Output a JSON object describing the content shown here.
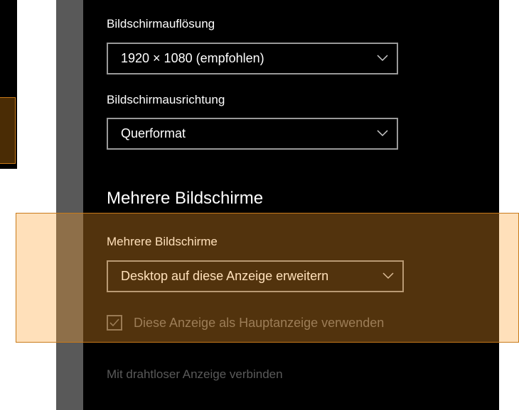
{
  "display": {
    "resolution_label": "Bildschirmauflösung",
    "resolution_value": "1920 × 1080 (empfohlen)",
    "orientation_label": "Bildschirmausrichtung",
    "orientation_value": "Querformat"
  },
  "multi_display": {
    "section_title": "Mehrere Bildschirme",
    "select_label": "Mehrere Bildschirme",
    "select_value": "Desktop auf diese Anzeige erweitern",
    "main_display_checkbox_label": "Diese Anzeige als Hauptanzeige verwenden",
    "main_display_checked": true,
    "wireless_link": "Mit drahtloser Anzeige verbinden"
  },
  "colors": {
    "background": "#000000",
    "text": "#ffffff",
    "disabled_text": "#6e6e6e",
    "highlight_border": "#c87a1a",
    "highlight_fill": "#ffa028"
  },
  "icons": {
    "dropdown": "chevron-down-icon",
    "checkbox": "checkmark-icon"
  }
}
